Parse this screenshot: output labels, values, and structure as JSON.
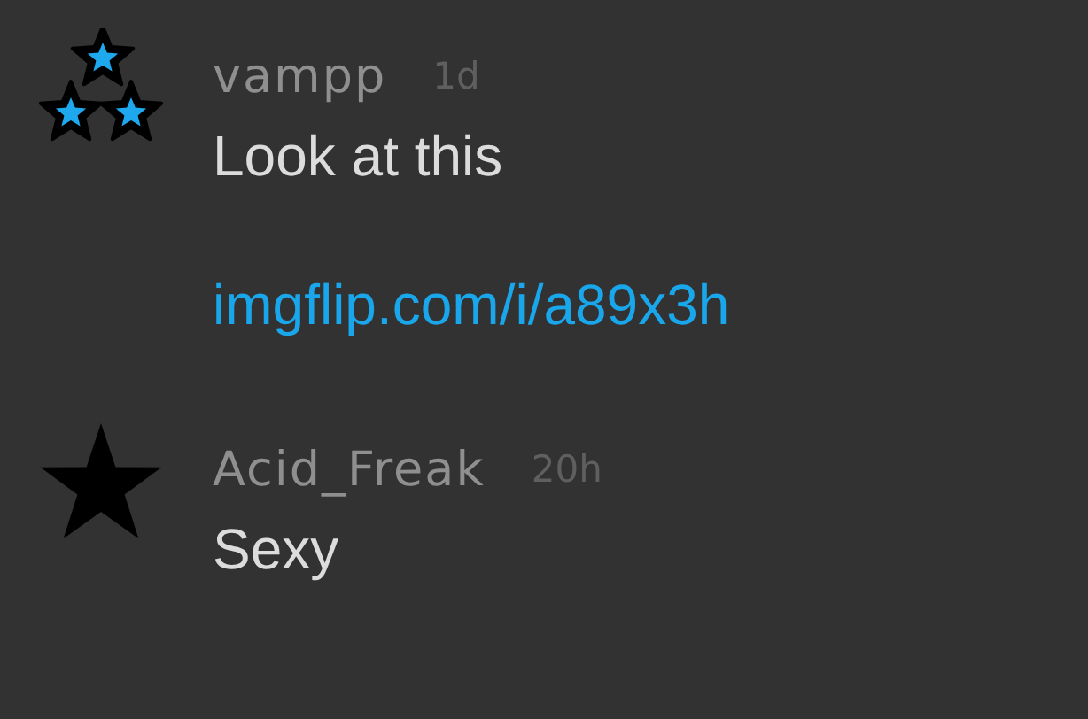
{
  "comments": [
    {
      "avatar": {
        "kind": "three-stars"
      },
      "username": "vampp",
      "age": "1d",
      "body": [
        {
          "kind": "text",
          "text": "Look at this"
        },
        {
          "kind": "link",
          "text": "imgflip.com/i/a89x3h"
        }
      ]
    },
    {
      "avatar": {
        "kind": "star"
      },
      "username": "Acid_Freak",
      "age": "20h",
      "body": [
        {
          "kind": "text",
          "text": "Sexy"
        }
      ]
    }
  ]
}
